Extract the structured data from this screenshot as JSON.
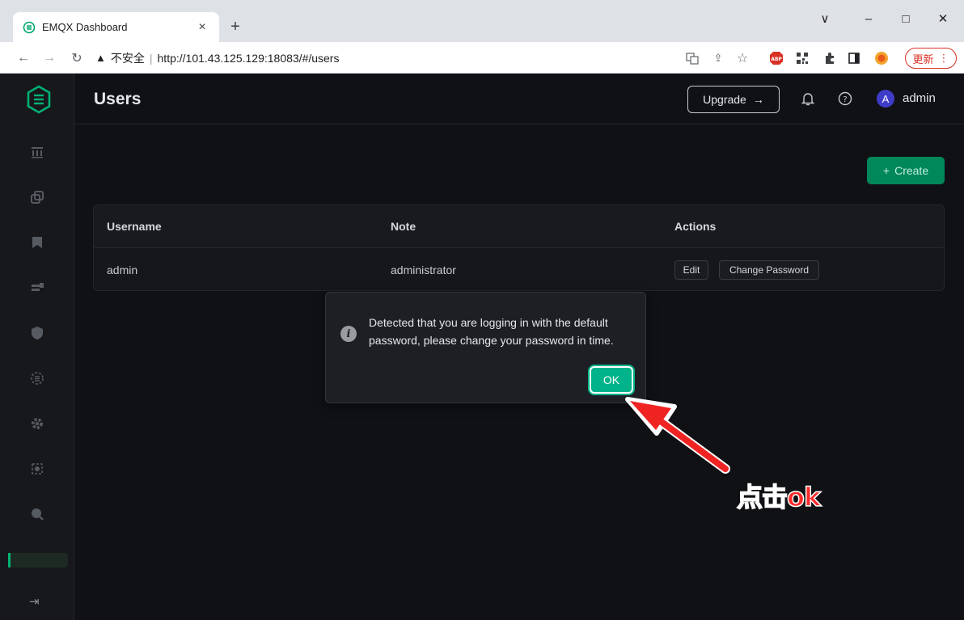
{
  "browser": {
    "tab_title": "EMQX Dashboard",
    "tab_close": "×",
    "new_tab": "+",
    "window_controls": {
      "minimize": "–",
      "maximize": "□",
      "close": "✕",
      "dropdown": "∨"
    },
    "insecure_label": "不安全",
    "url": "http://101.43.125.129:18083/#/users",
    "update_label": "更新",
    "update_menu": "⋮",
    "extensions": [
      "translate-icon",
      "share-icon",
      "bookmark-star-icon",
      "adblock-icon",
      "qr-icon",
      "puzzle-icon",
      "sidepanel-icon",
      "profile-icon"
    ]
  },
  "header": {
    "title": "Users",
    "upgrade_label": "Upgrade",
    "upgrade_arrow": "→",
    "avatar_letter": "A",
    "username": "admin"
  },
  "toolbar": {
    "create_label": "Create",
    "create_icon": "+"
  },
  "table": {
    "columns": [
      "Username",
      "Note",
      "Actions"
    ],
    "rows": [
      {
        "username": "admin",
        "note": "administrator",
        "actions": [
          "Edit",
          "Change Password"
        ]
      }
    ]
  },
  "dialog": {
    "icon": "i",
    "message": "Detected that you are logging in with the default password, please change your password in time.",
    "ok_label": "OK"
  },
  "annotation": {
    "text": "点击ok",
    "color": "#ff2a2a"
  },
  "colors": {
    "accent": "#00b173",
    "background": "#101115",
    "sidebar": "#17181c"
  }
}
